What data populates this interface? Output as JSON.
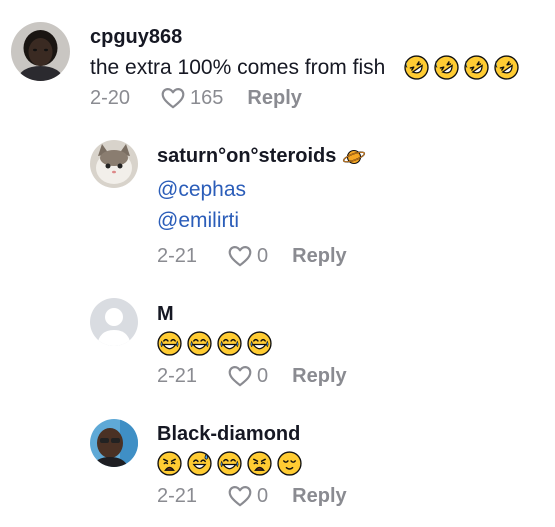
{
  "comments": [
    {
      "username": "cpguy868",
      "text": "the extra 100% comes from fish",
      "emojis": [
        "rofl",
        "rofl",
        "rofl",
        "rofl"
      ],
      "date": "2-20",
      "likes": "165",
      "reply_label": "Reply"
    },
    {
      "username": "saturn°on°steroids",
      "username_emoji": "ringed-planet",
      "mentions": [
        "@cephas",
        "@emilirti"
      ],
      "date": "2-21",
      "likes": "0",
      "reply_label": "Reply"
    },
    {
      "username": "M",
      "emojis": [
        "joy",
        "joy",
        "joy",
        "joy"
      ],
      "date": "2-21",
      "likes": "0",
      "reply_label": "Reply"
    },
    {
      "username": "Black-diamond",
      "emojis": [
        "weary",
        "sweat-smile",
        "joy",
        "weary",
        "relieved"
      ],
      "date": "2-21",
      "likes": "0",
      "reply_label": "Reply"
    }
  ]
}
